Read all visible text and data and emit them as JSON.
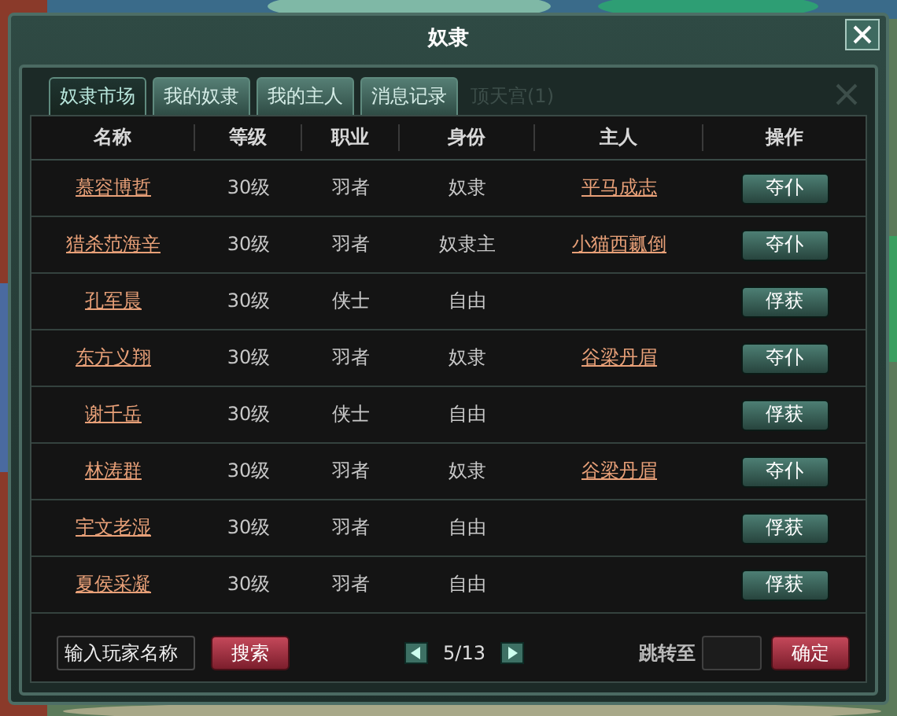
{
  "window": {
    "title": "奴隶"
  },
  "tabs": [
    {
      "label": "奴隶市场",
      "selected": true
    },
    {
      "label": "我的奴隶",
      "selected": false
    },
    {
      "label": "我的主人",
      "selected": false
    },
    {
      "label": "消息记录",
      "selected": false
    }
  ],
  "extra_tab": {
    "label": "顶天宫(1)",
    "disabled": true
  },
  "table": {
    "columns": [
      "名称",
      "等级",
      "职业",
      "身份",
      "主人",
      "操作"
    ],
    "rows": [
      {
        "name": "慕容博哲",
        "level": "30级",
        "job": "羽者",
        "status": "奴隶",
        "owner": "平马成志",
        "action": "夺仆"
      },
      {
        "name": "猎杀范海辛",
        "level": "30级",
        "job": "羽者",
        "status": "奴隶主",
        "owner": "小猫西瓤倒",
        "action": "夺仆"
      },
      {
        "name": "孔军晨",
        "level": "30级",
        "job": "侠士",
        "status": "自由",
        "action": "俘获"
      },
      {
        "name": "东方义翔",
        "level": "30级",
        "job": "羽者",
        "status": "奴隶",
        "owner": "谷梁丹眉",
        "action": "夺仆"
      },
      {
        "name": "谢千岳",
        "level": "30级",
        "job": "侠士",
        "status": "自由",
        "action": "俘获"
      },
      {
        "name": "林涛群",
        "level": "30级",
        "job": "羽者",
        "status": "奴隶",
        "owner": "谷梁丹眉",
        "action": "夺仆"
      },
      {
        "name": "宇文老湿",
        "level": "30级",
        "job": "羽者",
        "status": "自由",
        "action": "俘获"
      },
      {
        "name": "夏侯采凝",
        "level": "30级",
        "job": "羽者",
        "status": "自由",
        "action": "俘获"
      }
    ]
  },
  "footer": {
    "search_placeholder": "输入玩家名称",
    "search_button": "搜索",
    "page": "5/13",
    "jump_label": "跳转至",
    "confirm_button": "确定"
  }
}
